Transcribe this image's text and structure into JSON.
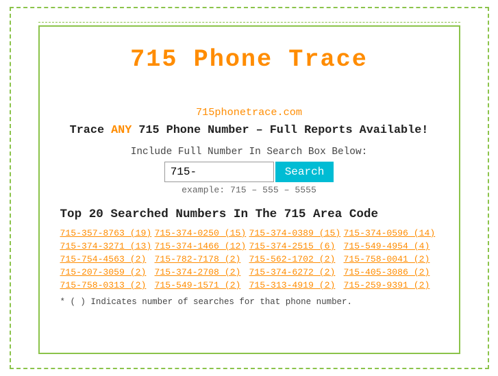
{
  "page": {
    "title": "715 Phone Trace",
    "site_url": "715phonetrace.com",
    "tagline_start": "Trace ",
    "tagline_any": "ANY",
    "tagline_end": " 715 Phone Number – Full Reports Available!",
    "search_label": "Include Full Number In Search Box Below:",
    "search_placeholder": "715-",
    "search_button_label": "Search",
    "search_example": "example: 715 – 555 – 5555",
    "section_title": "Top 20 Searched Numbers In The 715 Area Code",
    "footnote": "* ( ) Indicates number of searches for that phone number.",
    "numbers": [
      "715-357-8763 (19)",
      "715-374-0250 (15)",
      "715-374-0389 (15)",
      "715-374-0596 (14)",
      "715-374-3271 (13)",
      "715-374-1466 (12)",
      "715-374-2515 (6)",
      "715-549-4954 (4)",
      "715-754-4563 (2)",
      "715-782-7178 (2)",
      "715-562-1702 (2)",
      "715-758-0041 (2)",
      "715-207-3059 (2)",
      "715-374-2708 (2)",
      "715-374-6272 (2)",
      "715-405-3086 (2)",
      "715-758-0313 (2)",
      "715-549-1571 (2)",
      "715-313-4919 (2)",
      "715-259-9391 (2)"
    ]
  }
}
